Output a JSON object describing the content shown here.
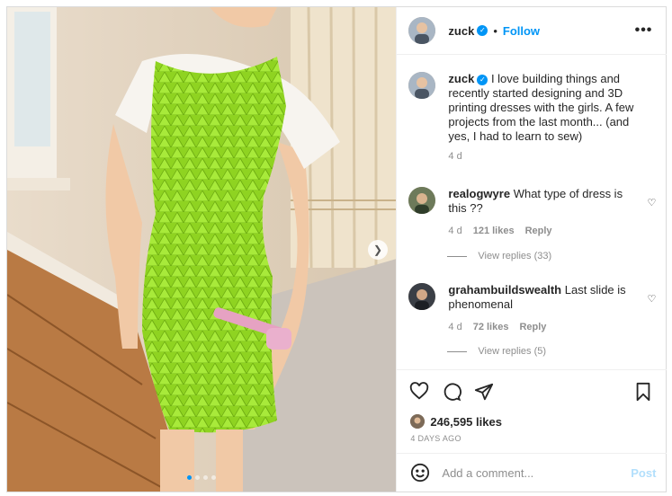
{
  "header": {
    "username": "zuck",
    "separator": "•",
    "follow_label": "Follow",
    "more_label": "•••"
  },
  "caption": {
    "username": "zuck",
    "text": "I love building things and recently started designing and 3D printing dresses with the girls. A few projects from the last month... (and yes, I had to learn to sew)",
    "time": "4 d"
  },
  "comments": [
    {
      "username": "realogwyre",
      "text": "What type of dress is this ??",
      "time": "4 d",
      "likes": "121 likes",
      "reply_label": "Reply",
      "view_replies": "View replies (33)"
    },
    {
      "username": "grahambuildswealth",
      "text": "Last slide is phenomenal",
      "time": "4 d",
      "likes": "72 likes",
      "reply_label": "Reply",
      "view_replies": "View replies (5)"
    }
  ],
  "media": {
    "next_icon": "chevron-right-icon",
    "dots": 4,
    "active_dot": 0
  },
  "actions": {
    "icons": [
      "heart-icon",
      "comment-icon",
      "share-icon",
      "bookmark-icon"
    ],
    "likes_count": "246,595 likes",
    "date": "4 DAYS AGO"
  },
  "composer": {
    "placeholder": "Add a comment...",
    "post_label": "Post"
  },
  "colors": {
    "accent": "#0095f6",
    "post_disabled": "#b2dffc",
    "dress": "#9be12a"
  }
}
